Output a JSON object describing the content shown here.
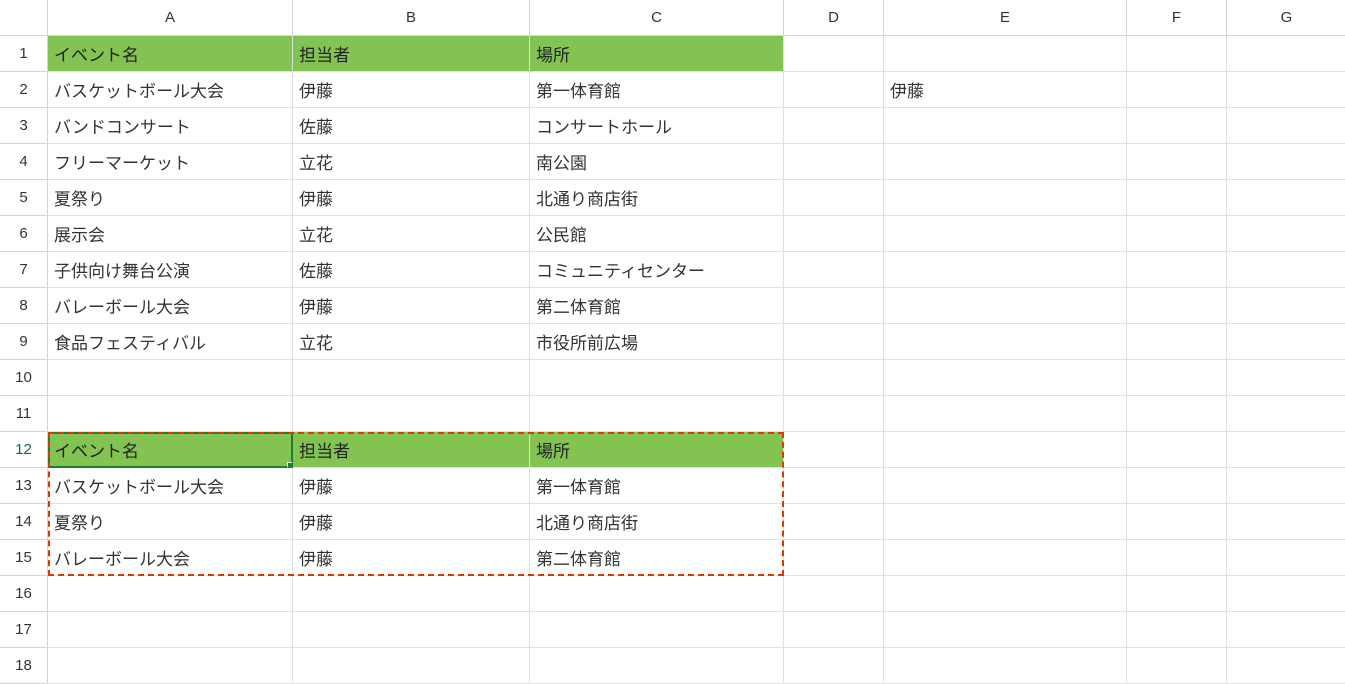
{
  "columns": [
    "A",
    "B",
    "C",
    "D",
    "E",
    "F",
    "G"
  ],
  "rows": [
    "1",
    "2",
    "3",
    "4",
    "5",
    "6",
    "7",
    "8",
    "9",
    "10",
    "11",
    "12",
    "13",
    "14",
    "15",
    "16",
    "17",
    "18"
  ],
  "headers1": {
    "A": "イベント名",
    "B": "担当者",
    "C": "場所"
  },
  "data1": [
    {
      "A": "バスケットボール大会",
      "B": "伊藤",
      "C": "第一体育館"
    },
    {
      "A": "バンドコンサート",
      "B": "佐藤",
      "C": "コンサートホール"
    },
    {
      "A": "フリーマーケット",
      "B": "立花",
      "C": "南公園"
    },
    {
      "A": "夏祭り",
      "B": "伊藤",
      "C": "北通り商店街"
    },
    {
      "A": "展示会",
      "B": "立花",
      "C": "公民館"
    },
    {
      "A": "子供向け舞台公演",
      "B": "佐藤",
      "C": "コミュニティセンター"
    },
    {
      "A": "バレーボール大会",
      "B": "伊藤",
      "C": "第二体育館"
    },
    {
      "A": "食品フェスティバル",
      "B": "立花",
      "C": "市役所前広場"
    }
  ],
  "e2": "伊藤",
  "headers2": {
    "A": "イベント名",
    "B": "担当者",
    "C": "場所"
  },
  "data2": [
    {
      "A": "バスケットボール大会",
      "B": "伊藤",
      "C": "第一体育館"
    },
    {
      "A": "夏祭り",
      "B": "伊藤",
      "C": "北通り商店街"
    },
    {
      "A": "バレーボール大会",
      "B": "伊藤",
      "C": "第二体育館"
    }
  ],
  "active_cell": "A12",
  "marching_range": {
    "from": "A12",
    "to": "C15"
  },
  "header_fill": "#82c352"
}
